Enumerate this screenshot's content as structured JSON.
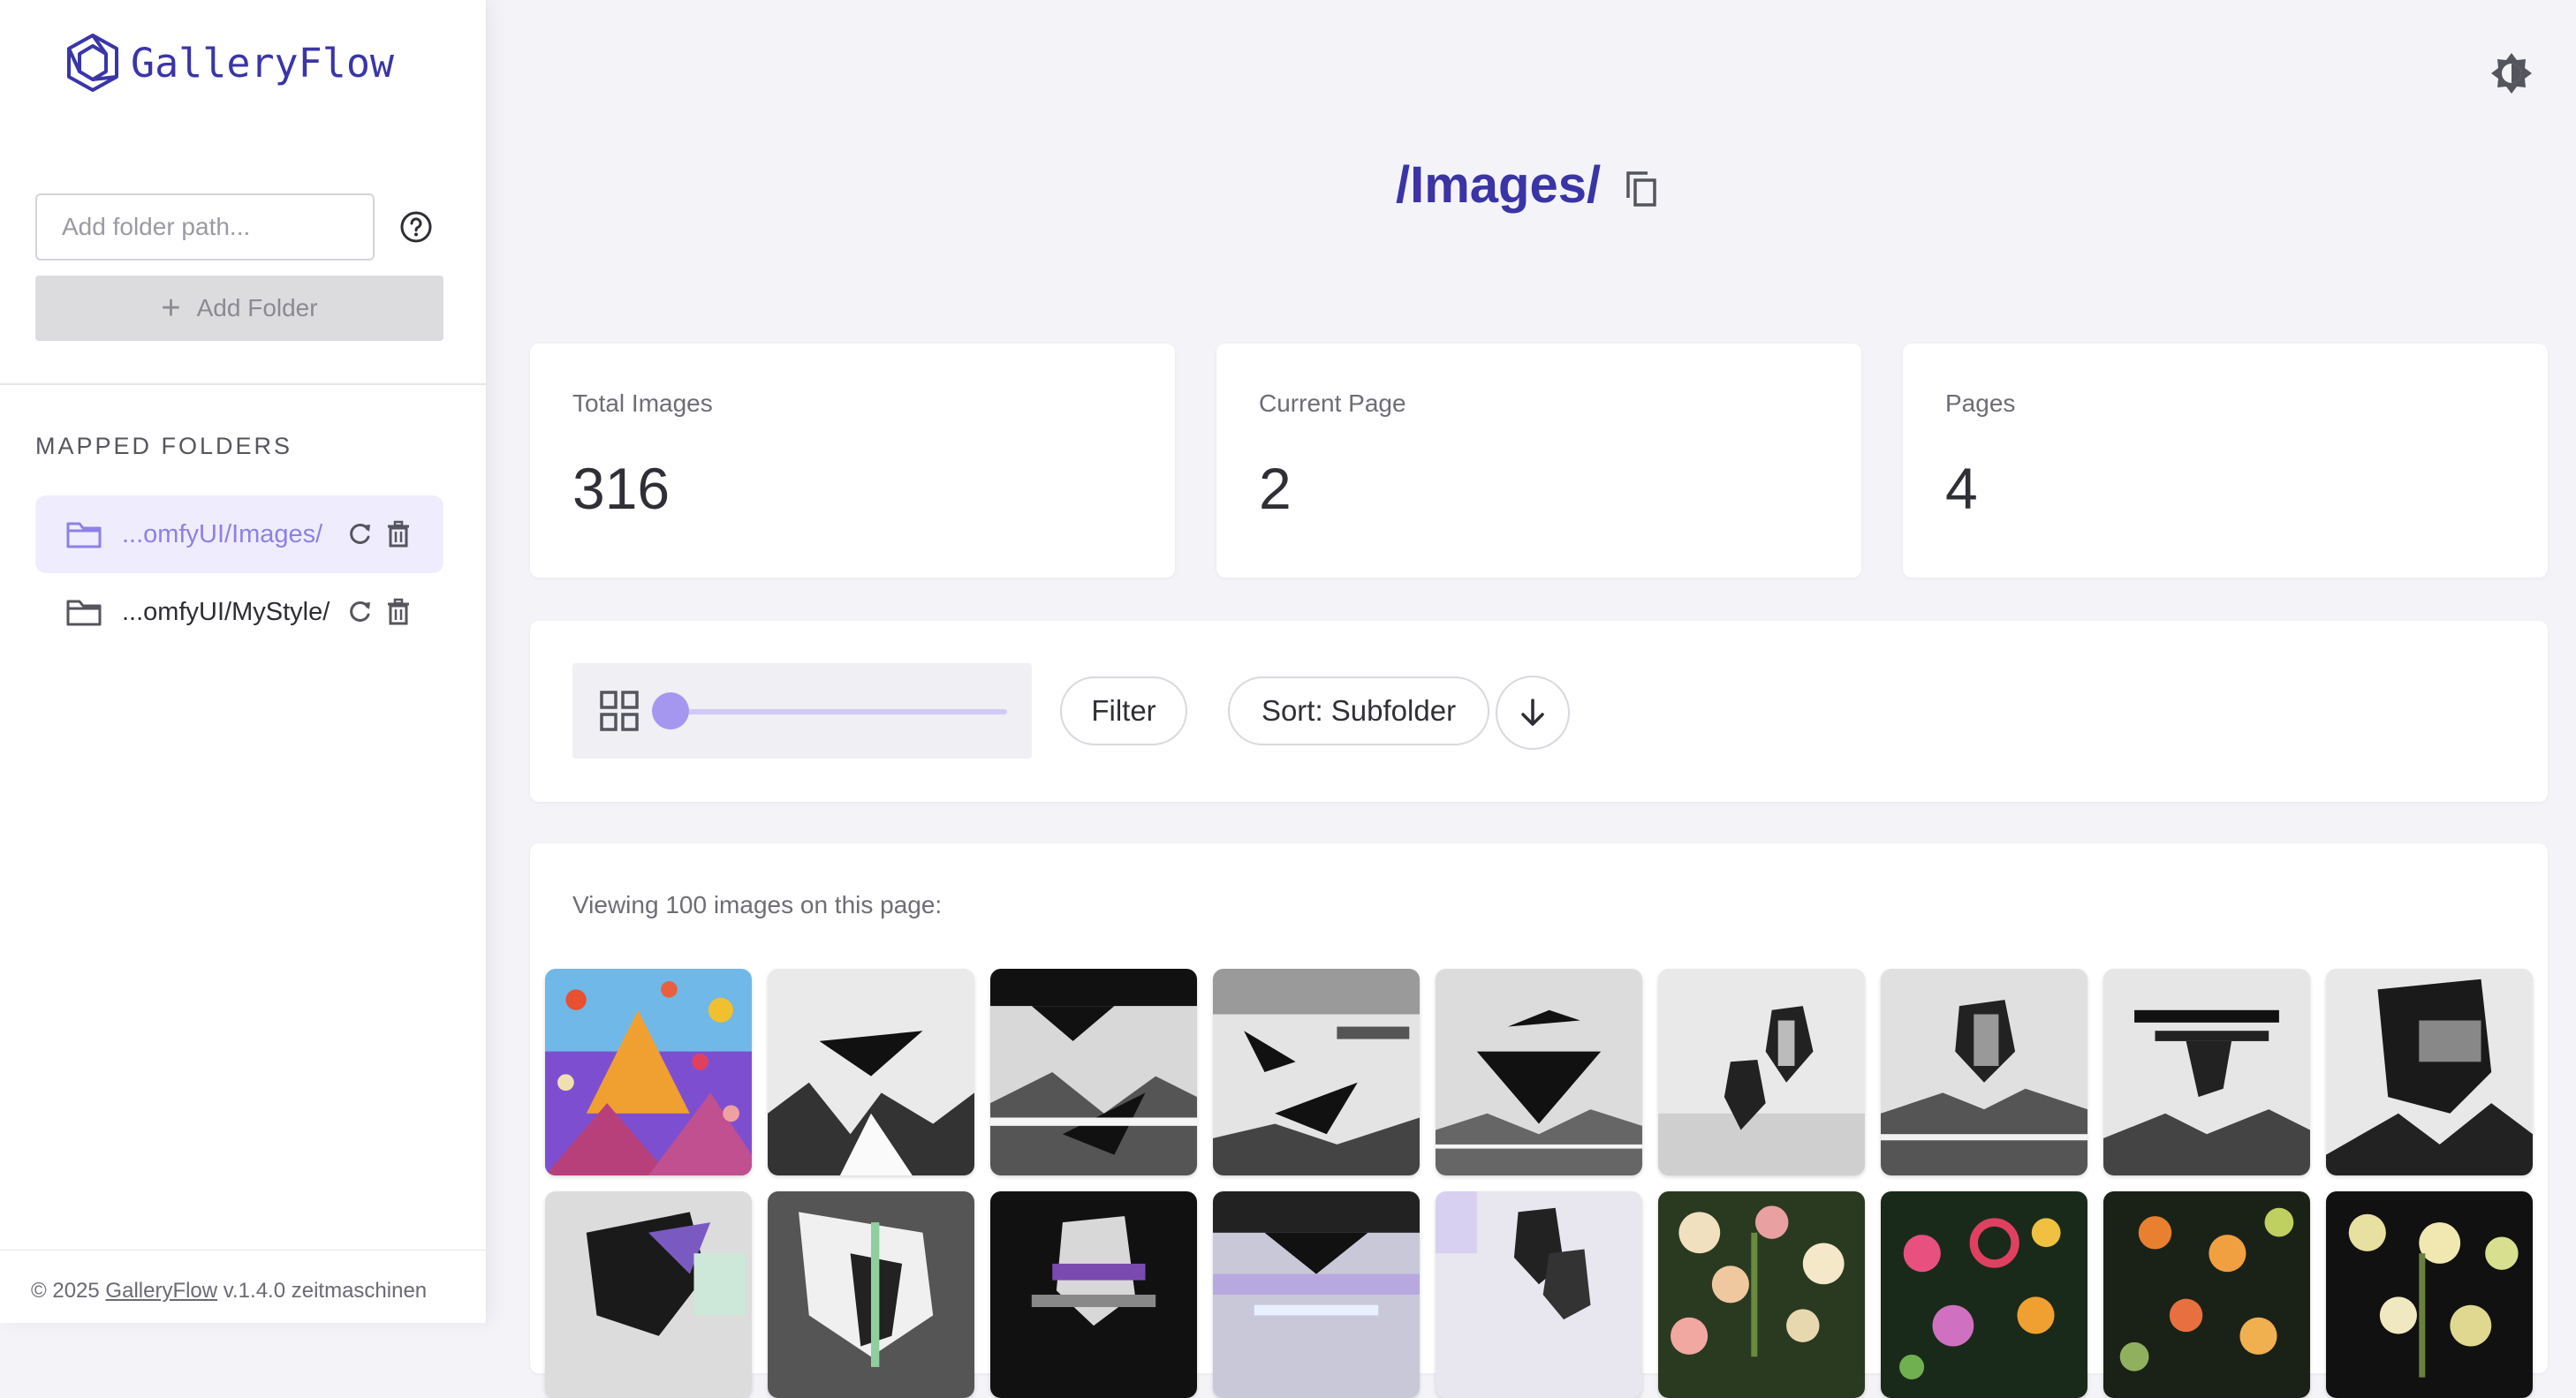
{
  "app": {
    "name": "GalleryFlow"
  },
  "sidebar": {
    "folder_input_placeholder": "Add folder path...",
    "add_folder_label": "Add Folder",
    "mapped_folders_title": "MAPPED FOLDERS",
    "folders": [
      {
        "label": "...omfyUI/Images/",
        "active": true
      },
      {
        "label": "...omfyUI/MyStyle/",
        "active": false
      }
    ],
    "footer": {
      "prefix": "© 2025 ",
      "link": "GalleryFlow",
      "suffix": " v.1.4.0 zeitmaschinen"
    }
  },
  "header": {
    "title": "/Images/"
  },
  "stats": [
    {
      "label": "Total Images",
      "value": "316"
    },
    {
      "label": "Current Page",
      "value": "2"
    },
    {
      "label": "Pages",
      "value": "4"
    }
  ],
  "toolbar": {
    "filter_label": "Filter",
    "sort_label": "Sort: Subfolder",
    "thumbnail_size": 0
  },
  "gallery": {
    "viewing_text": "Viewing 100 images on this page:",
    "thumbnails": [
      "colorful-tent-scene",
      "bw-abstract-mountain",
      "bw-glitch-landscape",
      "bw-floating-shards",
      "bw-inverted-pyramid",
      "bw-twin-faces",
      "bw-face-reflection",
      "bw-glitch-face",
      "bw-profile-mountains",
      "purple-profile-glitch",
      "bw-profile-glitch",
      "purple-face-glitch",
      "pastel-glitch-landscape",
      "bw-faces-purple",
      "floral-pattern-cream",
      "floral-pattern-pink",
      "floral-pattern-orange",
      "floral-pattern-yellow"
    ]
  },
  "colors": {
    "accent": "#3a34a6",
    "active_folder_bg": "#efedfd",
    "slider": "#a597f0"
  }
}
